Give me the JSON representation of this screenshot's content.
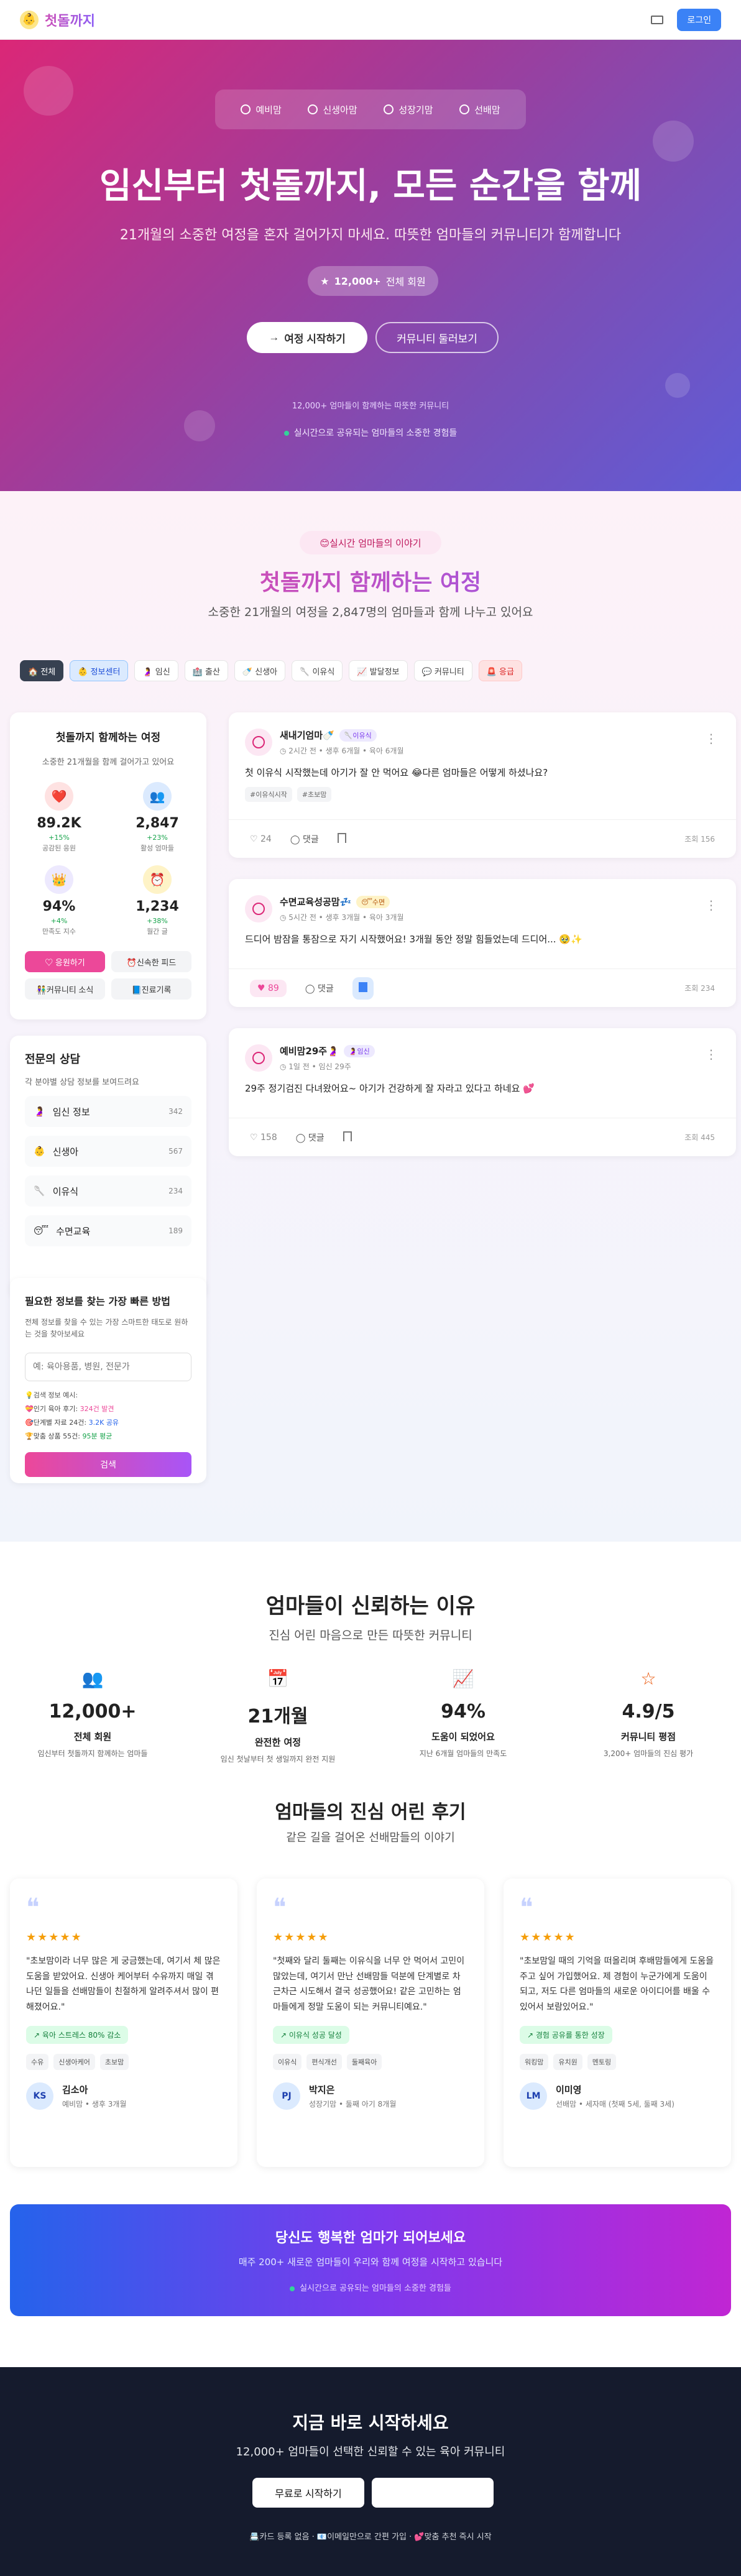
{
  "header": {
    "logo": "첫돌까지",
    "login": "로그인"
  },
  "hero": {
    "nav": [
      "예비맘",
      "신생아맘",
      "성장기맘",
      "선배맘"
    ],
    "title": "임신부터 첫돌까지, 모든 순간을 함께",
    "subtitle": "21개월의 소중한 여정을 혼자 걸어가지 마세요. 따뜻한 엄마들의 커뮤니티가 함께합니다",
    "badge_count": "12,000+",
    "badge_label": "전체 회원",
    "start_btn": "여정 시작하기",
    "comm_btn": "커뮤니티 둘러보기",
    "small_text": "12,000+ 엄마들이 함께하는 따뜻한 커뮤니티",
    "live_text": "실시간으로 공유되는 엄마들의 소중한 경험들"
  },
  "community": {
    "pill": "😊실시간 엄마들의 이야기",
    "title": "첫돌까지 함께하는 여정",
    "subtitle": "소중한 21개월의 여정을 2,847명의 엄마들과 함께 나누고 있어요",
    "categories": [
      "🏠 전체",
      "👶 정보센터",
      "🤰 임신",
      "🏥 출산",
      "🍼 신생아",
      "🥄 이유식",
      "📈 발달정보",
      "💬 커뮤니티",
      "🚨 응급"
    ]
  },
  "sidebar": {
    "title": "첫돌까지 함께하는 여정",
    "subtitle": "소중한 21개월을 함께 걸어가고 있어요",
    "stats": [
      {
        "icon": "❤️",
        "value": "89.2K",
        "delta": "+15%",
        "label": "공감된 응원"
      },
      {
        "icon": "👥",
        "value": "2,847",
        "delta": "+23%",
        "label": "활성 엄마들"
      },
      {
        "icon": "👑",
        "value": "94%",
        "delta": "+4%",
        "label": "만족도 지수"
      },
      {
        "icon": "⏰",
        "value": "1,234",
        "delta": "+38%",
        "label": "월간 글"
      }
    ],
    "buttons": [
      "♡ 응원하기",
      "⏰신속한 피드",
      "👫커뮤니티 소식",
      "📘진료기록"
    ],
    "expert_title": "전문의 상담",
    "expert_sub": "각 분야별 상담 정보를 보여드려요",
    "experts": [
      {
        "icon": "🤰",
        "label": "임신 정보",
        "count": "342"
      },
      {
        "icon": "👶",
        "label": "신생아",
        "count": "567"
      },
      {
        "icon": "🥄",
        "label": "이유식",
        "count": "234"
      },
      {
        "icon": "😴",
        "label": "수면교육",
        "count": "189"
      }
    ],
    "search_title": "필요한 정보를 찾는 가장 빠른 방법",
    "search_sub": "전체 정보를 찾을 수 있는 가장 스마트한 태도로 원하는 것을 찾아보세요",
    "search_placeholder": "예: 육아용품, 병원, 전문가",
    "tips_title": "💡검색 정보 예시:",
    "tips": [
      {
        "pre": "💝인기 육아 후기: ",
        "hi": "324건 발견"
      },
      {
        "pre": "🎯단계별 자료 24건: ",
        "hi": "3.2K 공유"
      },
      {
        "pre": "🏆맞춤 상품 55건: ",
        "hi": "95분 평균"
      }
    ],
    "search_btn": "검색"
  },
  "posts": [
    {
      "name": "새내기엄마🍼",
      "tag": "🥄이유식",
      "meta": "2시간 전 • 생후 6개월 • 육아 6개월",
      "text": "첫 이유식 시작했는데 아기가 잘 안 먹어요 😂다른 엄마들은 어떻게 하셨나요?",
      "tags": [
        "#이유식시작",
        "#초보맘"
      ],
      "likes": "24",
      "comment": "댓글",
      "views": "조회 156"
    },
    {
      "name": "수면교육성공맘💤",
      "tag": "😴수면",
      "meta": "5시간 전 • 생후 3개월 • 육아 3개월",
      "text": "드디어 밤잠을 통잠으로 자기 시작했어요! 3개월 동안 정말 힘들었는데 드디어... 🥹✨",
      "tags": [],
      "likes": "89",
      "comment": "댓글",
      "views": "조회 234"
    },
    {
      "name": "예비맘29주🤰",
      "tag": "🤰임신",
      "meta": "1일 전 • 임신 29주",
      "text": "29주 정기검진 다녀왔어요~ 아기가 건강하게 잘 자라고 있다고 하네요 💕",
      "tags": [],
      "likes": "158",
      "comment": "댓글",
      "views": "조회 445"
    }
  ],
  "trust": {
    "title": "엄마들이 신뢰하는 이유",
    "subtitle": "진심 어린 마음으로 만든 따뜻한 커뮤니티",
    "stats": [
      {
        "icon": "👥",
        "value": "12,000+",
        "label": "전체 회원",
        "desc": "임신부터 첫돌까지 함께하는 엄마들"
      },
      {
        "icon": "📅",
        "value": "21개월",
        "label": "완전한 여정",
        "desc": "임신 첫날부터 첫 생일까지 완전 지원"
      },
      {
        "icon": "📈",
        "value": "94%",
        "label": "도움이 되었어요",
        "desc": "지난 6개월 엄마들의 만족도"
      },
      {
        "icon": "☆",
        "value": "4.9/5",
        "label": "커뮤니티 평점",
        "desc": "3,200+ 엄마들의 진심 평가"
      }
    ],
    "reviews_title": "엄마들의 진심 어린 후기",
    "reviews_sub": "같은 길을 걸어온 선배맘들의 이야기",
    "reviews": [
      {
        "stars": "★★★★★",
        "text": "\"초보맘이라 너무 많은 게 궁금했는데, 여기서 체 많은 도움을 받았어요. 신생아 케어부터 수유까지 매일 겪나던 일들을 선배맘들이 친절하게 알려주셔서 많이 편해졌어요.\"",
        "badge": "↗ 육아 스트레스 80% 감소",
        "tags": [
          "수유",
          "신생아케어",
          "초보맘"
        ],
        "initials": "KS",
        "name": "김소아",
        "desc": "예비맘 • 생후 3개월"
      },
      {
        "stars": "★★★★★",
        "text": "\"첫째와 달리 둘째는 이유식을 너무 안 먹어서 고민이 많았는데, 여기서 만난 선배맘들 덕분에 단계별로 차근차근 시도해서 결국 성공했어요! 같은 고민하는 엄마들에게 정말 도움이 되는 커뮤니티예요.\"",
        "badge": "↗ 이유식 성공 달성",
        "tags": [
          "이유식",
          "편식개선",
          "둘째육아"
        ],
        "initials": "PJ",
        "name": "박지은",
        "desc": "성장기맘 • 둘째 아기 8개월"
      },
      {
        "stars": "★★★★★",
        "text": "\"초보맘일 때의 기억을 떠올리며 후배맘들에게 도움을 주고 싶어 가입했어요. 제 경험이 누군가에게 도움이 되고, 저도 다른 엄마들의 새로운 아이디어를 배울 수 있어서 보람있어요.\"",
        "badge": "↗ 경험 공유를 통한 성장",
        "tags": [
          "워킹맘",
          "유치원",
          "멘토링"
        ],
        "initials": "LM",
        "name": "이미영",
        "desc": "선배맘 • 세자매 (첫째 5세, 둘째 3세)"
      }
    ]
  },
  "cta": {
    "title": "당신도 행복한 엄마가 되어보세요",
    "subtitle": "매주 200+ 새로운 엄마들이 우리와 함께 여정을 시작하고 있습니다",
    "live": "실시간으로 공유되는 엄마들의 소중한 경험들"
  },
  "footer": {
    "title": "지금 바로 시작하세요",
    "subtitle": "12,000+ 엄마들이 선택한 신뢰할 수 있는 육아 커뮤니티",
    "btn1": "무료로 시작하기",
    "links": "📇카드 등록 없음 · 📧이메일만으로 간편 가입 · 💕맞춤 추천 즉시 시작"
  }
}
